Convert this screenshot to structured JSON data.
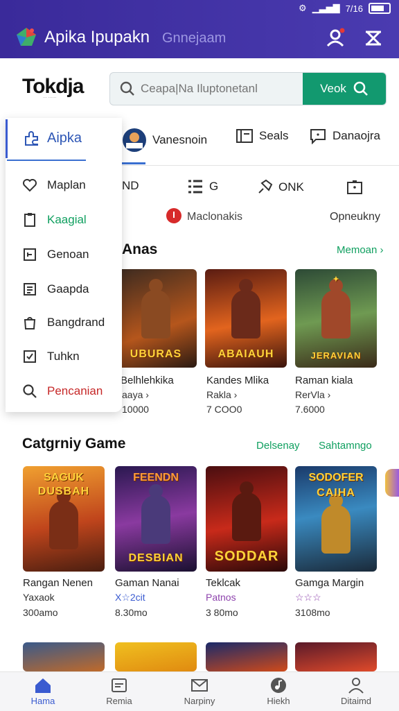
{
  "status": {
    "time": "7/16"
  },
  "header": {
    "title": "Apika Ipupakn",
    "subtitle": "Gnnejaam"
  },
  "brand": {
    "name": "Tokdja",
    "tagline": "··· ······"
  },
  "search": {
    "placeholder": "Ceapa|Na Iluptonetanl",
    "button_label": "Veok"
  },
  "tabs": [
    {
      "label": "Vanesnoin",
      "icon": "avatar-icon"
    },
    {
      "label": "Seals",
      "icon": "calendar-icon"
    },
    {
      "label": "Danaojra",
      "icon": "chat-icon"
    }
  ],
  "icon_row": [
    {
      "label": "ND",
      "icon": "none"
    },
    {
      "label": "G",
      "icon": "list-icon"
    },
    {
      "label": "ONK",
      "icon": "pin-icon"
    },
    {
      "label": "",
      "icon": "box-icon"
    }
  ],
  "sub_row": {
    "label": "Maclonakis",
    "right": "Opneukny"
  },
  "sidebar": {
    "header": "Aipka",
    "items": [
      {
        "label": "Maplan",
        "icon": "heart-icon",
        "color": "#222222"
      },
      {
        "label": "Kaagial",
        "icon": "clipboard-icon",
        "color": "#0f9f5f"
      },
      {
        "label": "Genoan",
        "icon": "tag-icon",
        "color": "#222222"
      },
      {
        "label": "Gaapda",
        "icon": "list-box-icon",
        "color": "#222222"
      },
      {
        "label": "Bangdrand",
        "icon": "bag-icon",
        "color": "#222222"
      },
      {
        "label": "Tuhkn",
        "icon": "check-box-icon",
        "color": "#222222"
      },
      {
        "label": "Pencanian",
        "icon": "search-icon",
        "color": "#c62828"
      }
    ]
  },
  "section1": {
    "title": "Anas",
    "link": "Memoan ›",
    "cards": [
      {
        "title": "Belhlehkika",
        "sub": "aaya ›",
        "price": "10000",
        "art_text": "UBURAS"
      },
      {
        "title": "Kandes Mlika",
        "sub": "Rakla ›",
        "price": "7 COO0",
        "art_text": "ABAIAUH"
      },
      {
        "title": "Raman kiala",
        "sub": "RerVla ›",
        "price": "7.6000",
        "art_text": "JERAVIAN"
      }
    ]
  },
  "section2": {
    "title": "Catgrniy Game",
    "link1": "Delsenay",
    "link2": "Sahtamngo",
    "cards": [
      {
        "title": "Rangan Nenen",
        "sub": "Yaxaok",
        "price": "300amo",
        "art_top": "SAGUK",
        "art_text": "DUSBAH",
        "sub_color": "#333333"
      },
      {
        "title": "Gaman Nanai",
        "sub": "X☆2cit",
        "price": "8.30mo",
        "art_top": "FEENDN",
        "art_text": "DESBIAN",
        "sub_color": "#3a5bd0"
      },
      {
        "title": "Teklcak",
        "sub": "Patnos",
        "price": "3 80mo",
        "art_top": "",
        "art_text": "SODDAR",
        "sub_color": "#8e44ad"
      },
      {
        "title": "Gamga Margin",
        "sub": "☆☆☆",
        "price": "3108mo",
        "art_top": "SODOFER",
        "art_text": "CAIHA",
        "sub_color": "#8e44ad"
      }
    ]
  },
  "nav": [
    {
      "label": "Hama",
      "icon": "home-icon",
      "active": true
    },
    {
      "label": "Remia",
      "icon": "card-icon",
      "active": false
    },
    {
      "label": "Narpiny",
      "icon": "mail-icon",
      "active": false
    },
    {
      "label": "Hiekh",
      "icon": "music-icon",
      "active": false
    },
    {
      "label": "Ditaimd",
      "icon": "user-icon",
      "active": false
    }
  ],
  "colors": {
    "header": "#3a2a9a",
    "accent_green": "#12996f",
    "accent_blue": "#3a5bd0"
  }
}
